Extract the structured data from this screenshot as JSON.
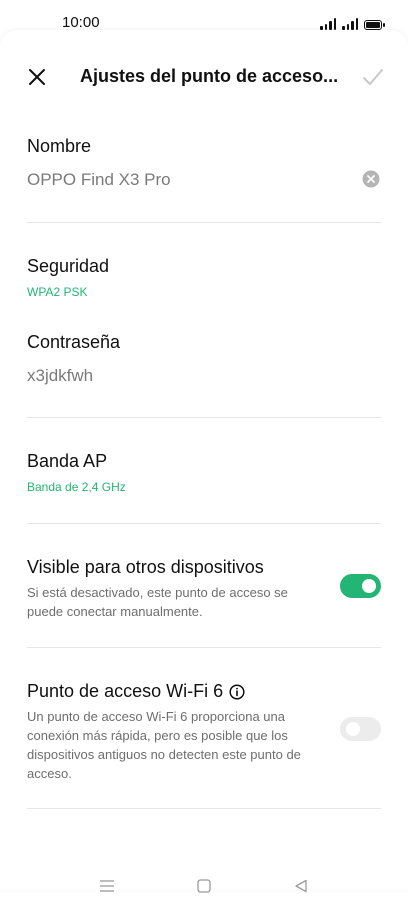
{
  "status_bar": {
    "time": "10:00"
  },
  "header": {
    "title": "Ajustes del punto de acceso..."
  },
  "name_section": {
    "label": "Nombre",
    "value": "OPPO Find X3 Pro"
  },
  "security_section": {
    "label": "Seguridad",
    "value": "WPA2 PSK"
  },
  "password_section": {
    "label": "Contraseña",
    "value": "x3jdkfwh"
  },
  "band_section": {
    "label": "Banda AP",
    "value": "Banda de 2,4 GHz"
  },
  "visible_section": {
    "label": "Visible para otros dispositivos",
    "description_line1": "Si está desactivado, este punto de acceso se",
    "description_line2": "puede conectar manualmente.",
    "enabled": true
  },
  "wifi6_section": {
    "label": "Punto de acceso Wi-Fi 6",
    "description_line1": "Un punto de acceso Wi-Fi 6 proporciona una",
    "description_line2": "conexión más rápida, pero es posible que los",
    "description_line3": "dispositivos antiguos no detecten este punto de",
    "description_line4": "acceso.",
    "enabled": false
  },
  "colors": {
    "accent": "#22b573",
    "text": "#111111",
    "muted": "#7a7a7a"
  },
  "icons": {
    "close": "close-icon",
    "confirm": "check-icon",
    "clear": "clear-icon",
    "info": "info-icon",
    "nav_menu": "menu-icon",
    "nav_home": "home-icon",
    "nav_back": "back-icon"
  }
}
